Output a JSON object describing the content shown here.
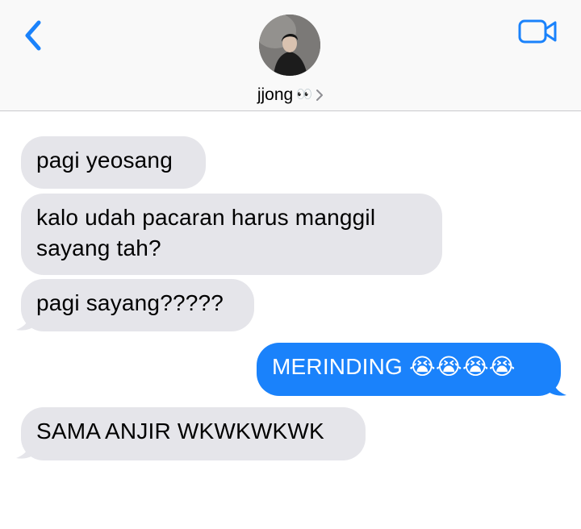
{
  "header": {
    "back_icon": "chevron-left-icon",
    "video_icon": "video-camera-icon",
    "avatar": "contact-avatar",
    "contact_name": "jjong",
    "contact_emoji": "👀",
    "accent_color": "#1a82fb"
  },
  "messages": [
    {
      "direction": "incoming",
      "text": "pagi yeosang"
    },
    {
      "direction": "incoming",
      "text": "kalo udah pacaran harus manggil sayang tah?"
    },
    {
      "direction": "incoming",
      "text": "pagi sayang?????"
    },
    {
      "direction": "outgoing",
      "text": "MERINDING 😭😭😭😭"
    },
    {
      "direction": "incoming",
      "text": "SAMA ANJIR WKWKWKWK"
    }
  ]
}
